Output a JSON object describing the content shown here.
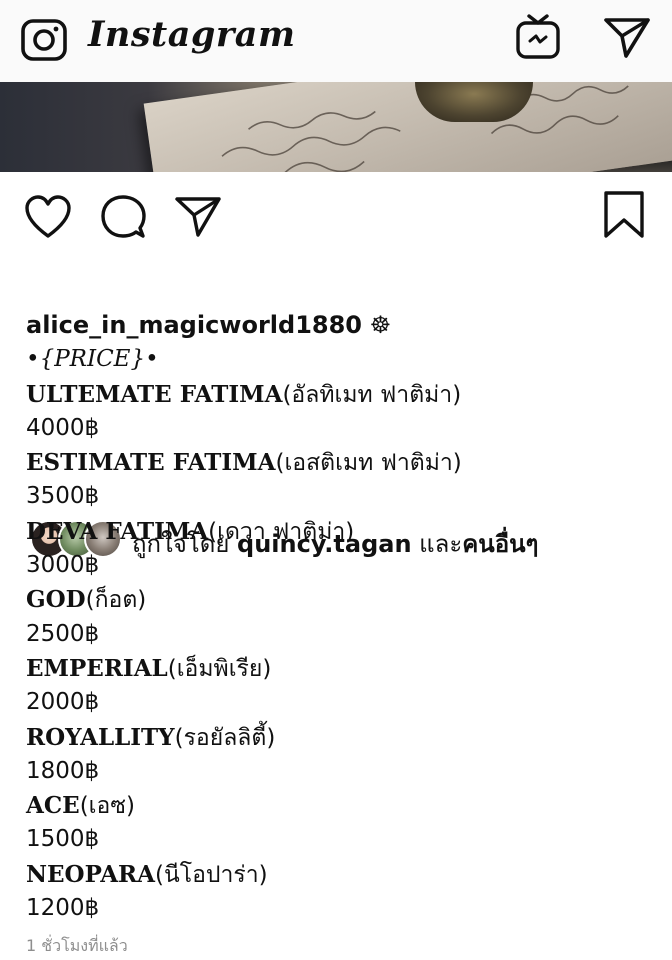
{
  "app": {
    "brand": "Instagram"
  },
  "icons": {
    "camera": "camera-icon",
    "igtv": "igtv-icon",
    "direct": "paper-plane-icon",
    "like": "heart-icon",
    "comment": "comment-icon",
    "share": "share-icon",
    "save": "bookmark-icon"
  },
  "post": {
    "liked_by_prefix": "ถูกใจโดย",
    "liked_by_user": "quincy.tagan",
    "liked_by_and": "และ",
    "liked_by_others": "คนอื่นๆ",
    "author": "alice_in_magicworld1880",
    "author_emoji": "☸",
    "price_title": "•{PRICE}•",
    "items": [
      {
        "name_en": "ULTEMATE FATIMA",
        "name_th": "(อัลทิเมท ฟาติม่า)",
        "price": "4000฿"
      },
      {
        "name_en": "ESTIMATE FATIMA",
        "name_th": "(เอสติเมท ฟาติม่า)",
        "price": "3500฿"
      },
      {
        "name_en": "DEVA FATIMA",
        "name_th": "(เดวา ฟาติม่า)",
        "price": "3000฿"
      },
      {
        "name_en": "GOD",
        "name_th": "(ก็อต)",
        "price": "2500฿"
      },
      {
        "name_en": "EMPERIAL",
        "name_th": "(เอ็มพิเรีย)",
        "price": "2000฿"
      },
      {
        "name_en": "ROYALLITY",
        "name_th": "(รอยัลลิตี้)",
        "price": "1800฿"
      },
      {
        "name_en": "ACE",
        "name_th": "(เอซ)",
        "price": "1500฿"
      },
      {
        "name_en": "NEOPARA",
        "name_th": "(นีโอปาร่า)",
        "price": "1200฿"
      }
    ],
    "timestamp": "1 ชั่วโมงที่แล้ว"
  },
  "colors": {
    "text": "#111111",
    "muted": "#8e8e8e",
    "topbar_bg": "#fafafa"
  }
}
